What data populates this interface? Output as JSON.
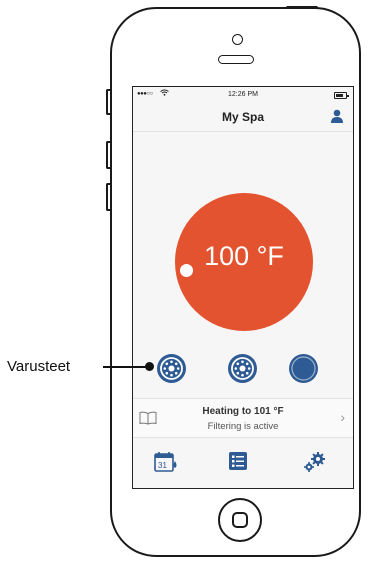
{
  "status_bar": {
    "signal": "●●●○○",
    "time": "12:26 PM"
  },
  "header": {
    "title": "My Spa"
  },
  "temperature": {
    "display": "100 °F",
    "color": "#e3532f"
  },
  "accessories": {
    "button_color": "#2e5b94",
    "count": 3
  },
  "info": {
    "main": "Heating to 101 °F",
    "sub": "Filtering is active",
    "chevron": "›"
  },
  "nav": {
    "items": [
      "calendar-icon",
      "list-icon",
      "settings-icon"
    ]
  },
  "callout": {
    "label": "Varusteet"
  }
}
